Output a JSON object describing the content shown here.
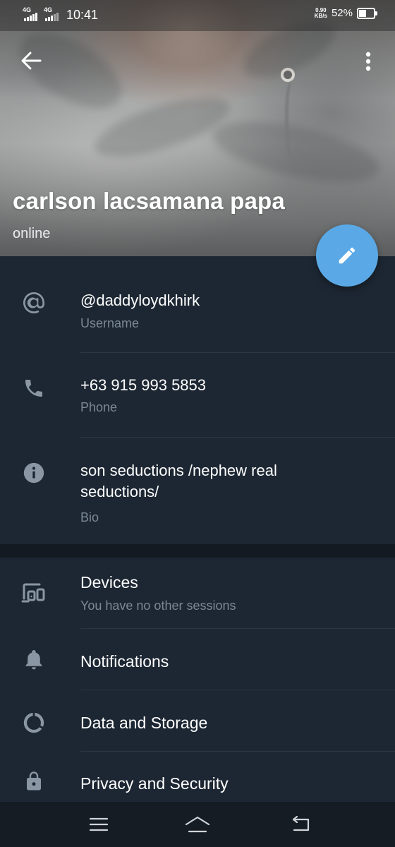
{
  "status_bar": {
    "network_1": "4G",
    "network_2": "4G",
    "time": "10:41",
    "speed_value": "0.90",
    "speed_unit": "KB/s",
    "battery_percent": "52%",
    "battery_level": 0.52
  },
  "profile": {
    "name": "carlson lacsamana papa",
    "status": "online"
  },
  "info": {
    "username": {
      "value": "@daddyloydkhirk",
      "label": "Username"
    },
    "phone": {
      "value": "+63 915 993 5853",
      "label": "Phone"
    },
    "bio": {
      "value_line1": "son seductions /nephew real",
      "value_line2": "seductions/",
      "label": "Bio"
    }
  },
  "settings": {
    "devices": {
      "label": "Devices",
      "sub": "You have no other sessions"
    },
    "notifications": {
      "label": "Notifications"
    },
    "data_storage": {
      "label": "Data and Storage"
    },
    "privacy": {
      "label": "Privacy and Security"
    }
  },
  "icons": {
    "back": "arrow-left-icon",
    "menu": "more-vertical-icon",
    "edit": "pencil-icon",
    "username": "at-sign-icon",
    "phone": "phone-icon",
    "bio": "info-icon",
    "devices": "devices-icon",
    "notifications": "bell-icon",
    "data_storage": "data-usage-icon",
    "privacy": "lock-icon"
  },
  "colors": {
    "accent": "#5aa9e6",
    "background": "#1d2733",
    "secondary_text": "#7c8895",
    "icon": "#8a96a3"
  }
}
